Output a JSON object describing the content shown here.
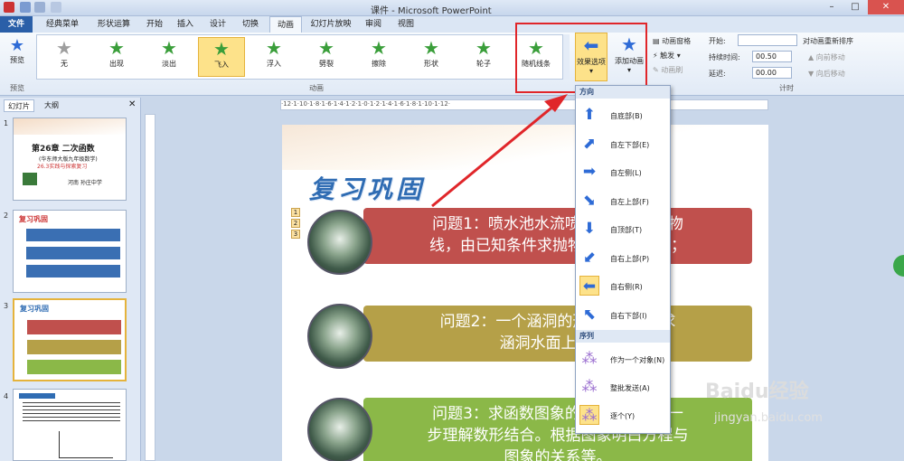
{
  "window": {
    "title": "课件 - Microsoft PowerPoint"
  },
  "tabs": [
    "文件",
    "经典菜单",
    "形状运算",
    "开始",
    "插入",
    "设计",
    "切换",
    "动画",
    "幻灯片放映",
    "审阅",
    "视图"
  ],
  "ribbon": {
    "preview_label": "预览",
    "preview_group": "预览",
    "animation_group": "动画",
    "timing_group": "计时",
    "animations": [
      {
        "label": "无",
        "color": "#9e9e9e"
      },
      {
        "label": "出现",
        "color": "#3a9e3a"
      },
      {
        "label": "淡出",
        "color": "#3a9e3a"
      },
      {
        "label": "飞入",
        "color": "#3a9e3a"
      },
      {
        "label": "浮入",
        "color": "#3a9e3a"
      },
      {
        "label": "劈裂",
        "color": "#3a9e3a"
      },
      {
        "label": "擦除",
        "color": "#3a9e3a"
      },
      {
        "label": "形状",
        "color": "#3a9e3a"
      },
      {
        "label": "轮子",
        "color": "#3a9e3a"
      },
      {
        "label": "随机线条",
        "color": "#3a9e3a"
      }
    ],
    "effect_options": "效果选项",
    "add_animation": "添加动画",
    "animation_pane": "动画窗格",
    "trigger": "触发",
    "animation_painter": "动画刷",
    "start_label": "开始:",
    "start_value": "",
    "duration_label": "持续时间:",
    "duration_value": "00.50",
    "delay_label": "延迟:",
    "delay_value": "00.00",
    "reorder_label": "对动画重新排序",
    "move_earlier": "向前移动",
    "move_later": "向后移动"
  },
  "left_pane": {
    "tabs": [
      "幻灯片",
      "大纲"
    ],
    "slide_numbers": [
      "1",
      "2",
      "3",
      "4"
    ],
    "slide1_title": "第26章 二次函数",
    "slide1_sub": "(华东师大版九年级数学)",
    "slide1_line": "26.3实践与探索复习",
    "slide1_footer": "河南    孙庄中学"
  },
  "ruler_text": "·12·1·10·1·8·1·6·1·4·1·2·1·0·1·2·1·4·1·6·1·8·1·10·1·12·",
  "slide": {
    "title": "复习巩固",
    "numbers": [
      "1",
      "2",
      "3"
    ],
    "q1": "问题1：喷水池水流喷出的抛物线，由已知条件求抛物线坐标；",
    "q1_line1": "问题1：喷水池水流喷",
    "q1_line1b": "抛物",
    "q1_line2": "线，由已知条件求抛物",
    "q1_line2b": "标；",
    "q2_line1": "问题2：一个涵洞的形",
    "q2_line1b": "求",
    "q2_line2": "涵洞水面上1.5处",
    "q3_line1": "问题3：求函数图象的",
    "q3_line1b": "进一",
    "q3_line2": "步理解数形结合。根据图象明白方程与",
    "q3_line3": "图象的关系等。"
  },
  "menu": {
    "direction_header": "方向",
    "sequence_header": "序列",
    "direction_items": [
      {
        "label": "自底部(B)",
        "icon": "arrow-up"
      },
      {
        "label": "自左下部(E)",
        "icon": "arrow-up-right"
      },
      {
        "label": "自左侧(L)",
        "icon": "arrow-right"
      },
      {
        "label": "自左上部(F)",
        "icon": "arrow-down-right"
      },
      {
        "label": "自顶部(T)",
        "icon": "arrow-down"
      },
      {
        "label": "自右上部(P)",
        "icon": "arrow-down-left"
      },
      {
        "label": "自右侧(R)",
        "icon": "arrow-left"
      },
      {
        "label": "自右下部(I)",
        "icon": "arrow-up-left"
      }
    ],
    "sequence_items": [
      {
        "label": "作为一个对象(N)"
      },
      {
        "label": "整批发送(A)"
      },
      {
        "label": "逐个(Y)"
      }
    ]
  },
  "watermark": {
    "brand": "Baidu经验",
    "url": "jingyan.baidu.com"
  },
  "colors": {
    "q1": "#c0504d",
    "q2": "#b5a048",
    "q3": "#8bb848",
    "accent": "#e0262a",
    "title": "#2f6cb3"
  }
}
